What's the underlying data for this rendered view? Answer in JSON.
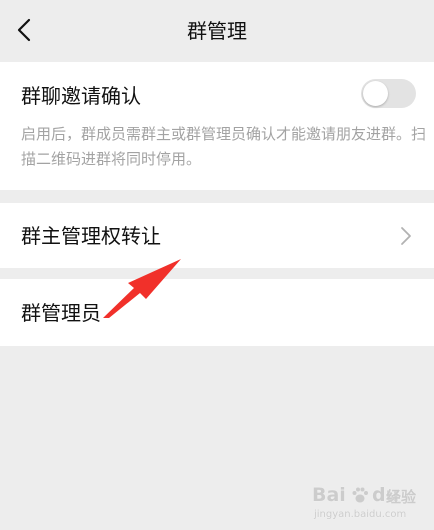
{
  "header": {
    "title": "群管理"
  },
  "invite_confirm": {
    "label": "群聊邀请确认",
    "enabled": false,
    "description": "启用后，群成员需群主或群管理员确认才能邀请朋友进群。扫描二维码进群将同时停用。"
  },
  "transfer": {
    "label": "群主管理权转让"
  },
  "admins": {
    "label": "群管理员"
  },
  "colors": {
    "background": "#ededed",
    "card": "#ffffff",
    "toggle_off": "#e3e3e3",
    "arrow": "#f1302a",
    "muted_text": "#a3a3a3"
  },
  "watermark": {
    "brand_left": "Bai",
    "brand_right": "du",
    "product": "经验",
    "url": "jingyan.baidu.com"
  }
}
